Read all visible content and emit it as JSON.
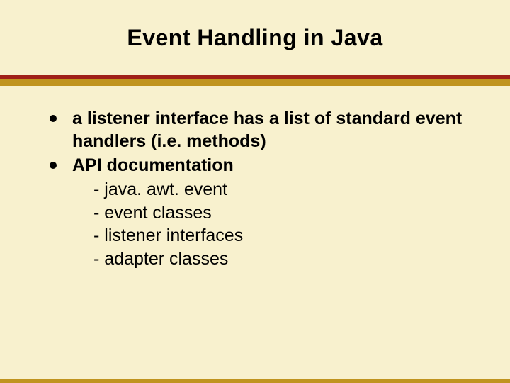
{
  "title": "Event Handling in Java",
  "bullets": {
    "b0": "a listener interface has a list of standard event handlers (i.e. methods)",
    "b1": "API documentation"
  },
  "subs": {
    "s0": "- java. awt. event",
    "s1": "- event classes",
    "s2": "- listener interfaces",
    "s3": "- adapter classes"
  }
}
